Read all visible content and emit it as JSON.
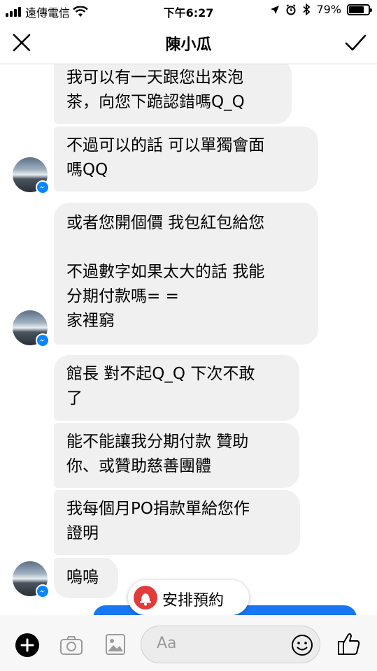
{
  "status_bar": {
    "carrier": "遠傳電信",
    "time": "下午6:27",
    "battery": "79%",
    "battery_level": 0.79
  },
  "header": {
    "title": "陳小瓜"
  },
  "messages": [
    "我可以有一天跟您出來泡\n茶，向您下跪認錯嗎Q_Q",
    "不過可以的話 可以單獨會面\n嗎QQ",
    "或者您開個價 我包紅包給您\n\n不過數字如果太大的話 我能\n分期付款嗎= =\n家裡窮",
    "館長 對不起Q_Q 下次不敢\n了",
    "能不能讓我分期付款 贊助\n你、或贊助慈善團體",
    "我每個月PO捐款單給您作\n證明",
    "嗚嗚"
  ],
  "appointment": {
    "label": "安排預約",
    "icon": "bell-icon"
  },
  "composer": {
    "placeholder": "Aa"
  },
  "icons": {
    "close": "close-icon",
    "done": "checkmark-icon",
    "plus": "plus-icon",
    "camera": "camera-icon",
    "gallery": "image-icon",
    "emoji": "smiley-icon",
    "like": "thumbs-up-icon",
    "messenger_badge": "messenger-badge-icon"
  },
  "colors": {
    "bubble": "#f1f0f0",
    "accent": "#1877f2",
    "appointment_icon": "#e23b3b"
  }
}
